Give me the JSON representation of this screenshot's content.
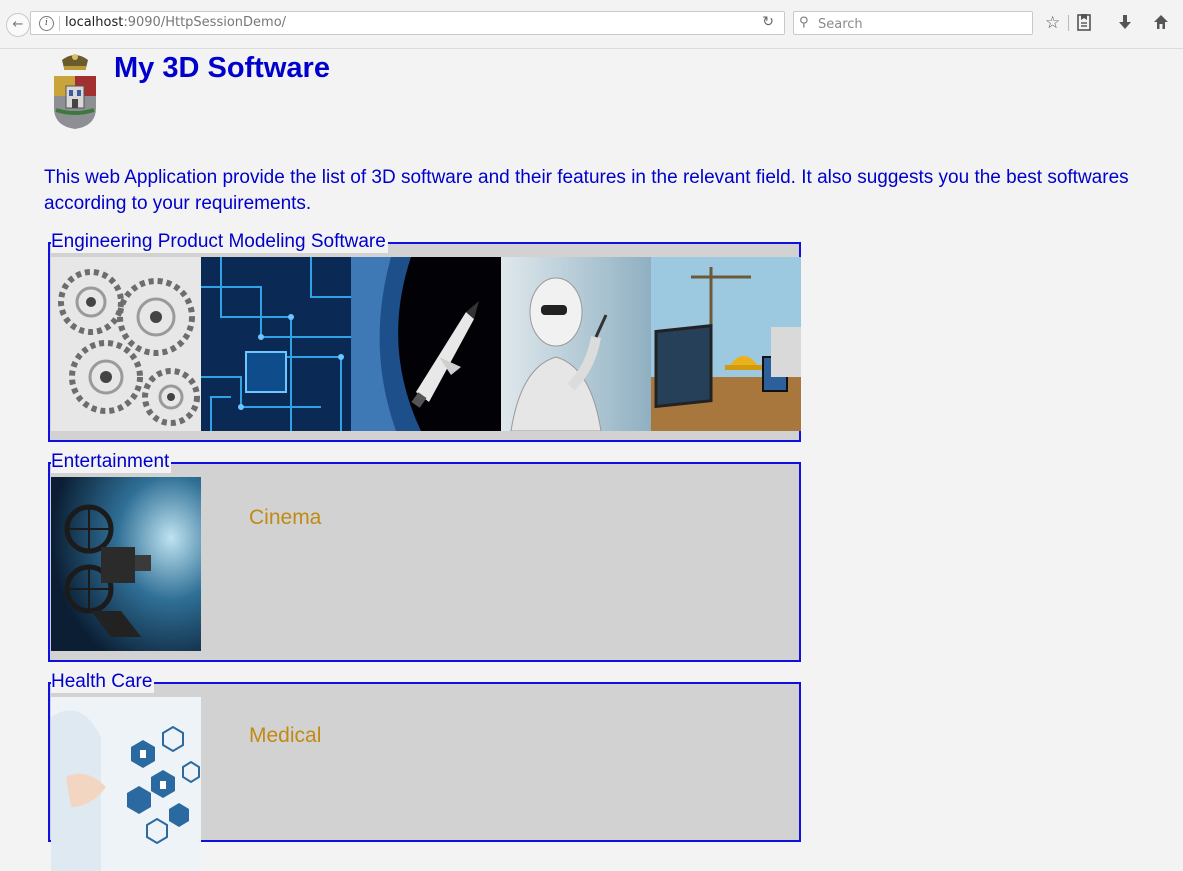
{
  "browser": {
    "url_host": "localhost",
    "url_rest": ":9090/HttpSessionDemo/",
    "search_placeholder": "Search"
  },
  "header": {
    "title": "My 3D Software"
  },
  "intro": "This web Application provide the list of 3D software and their features in the relevant field. It also suggests you the best softwares according to your requirements.",
  "sections": [
    {
      "legend": "Engineering Product Modeling Software",
      "images": [
        "gears",
        "circuit-board",
        "space-shuttle",
        "robot",
        "construction-tablet"
      ]
    },
    {
      "legend": "Entertainment",
      "image": "film-projector",
      "caption": "Cinema"
    },
    {
      "legend": "Health Care",
      "image": "medical-icons",
      "caption": "Medical"
    }
  ],
  "colors": {
    "link_blue": "#0000cc",
    "caption_gold": "#c08a14",
    "fieldset_border": "#1010e0",
    "panel_gray": "#d2d2d2"
  }
}
